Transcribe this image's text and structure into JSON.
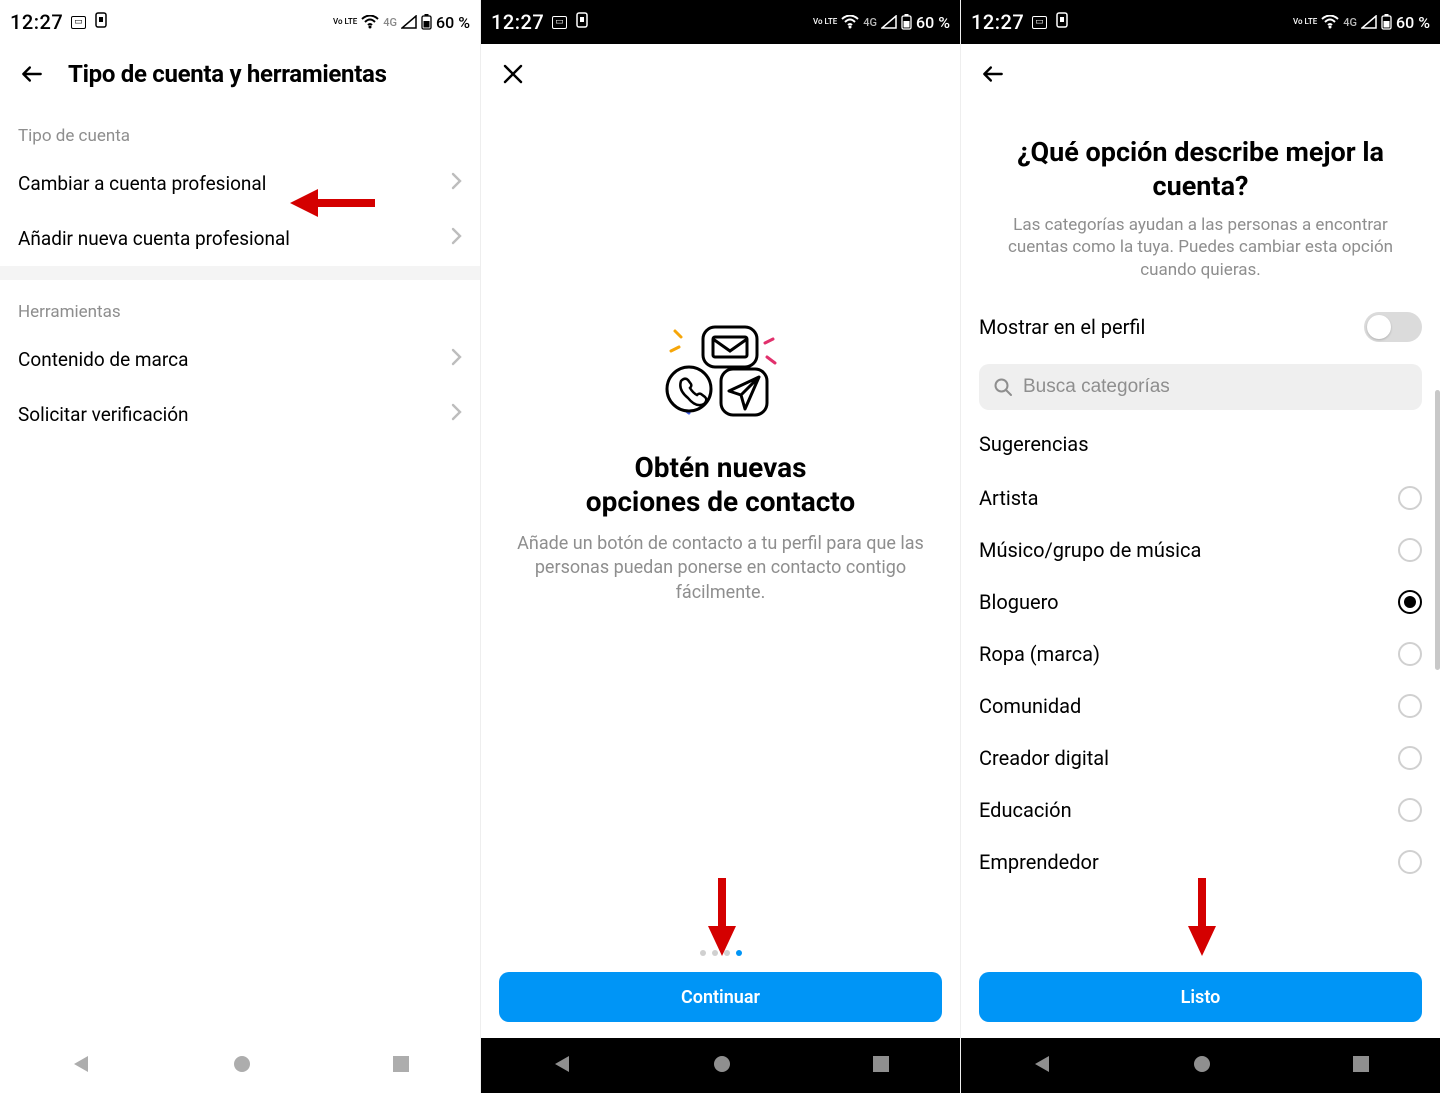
{
  "status": {
    "time": "12:27",
    "battery_text": "60 %",
    "network_label": "4G",
    "lte_label": "Vo LTE"
  },
  "screen1": {
    "title": "Tipo de cuenta y herramientas",
    "section_account": "Tipo de cuenta",
    "item_switch": "Cambiar a cuenta profesional",
    "item_add": "Añadir nueva cuenta profesional",
    "section_tools": "Herramientas",
    "item_branded": "Contenido de marca",
    "item_verify": "Solicitar verificación"
  },
  "screen2": {
    "title_line1": "Obtén nuevas",
    "title_line2": "opciones de contacto",
    "desc": "Añade un botón de contacto a tu perfil para que las personas puedan ponerse en contacto contigo fácilmente.",
    "button": "Continuar",
    "dots_total": 4,
    "dots_active_index": 3
  },
  "screen3": {
    "title": "¿Qué opción describe mejor la cuenta?",
    "desc": "Las categorías ayudan a las personas a encontrar cuentas como la tuya. Puedes cambiar esta opción cuando quieras.",
    "toggle_label": "Mostrar en el perfil",
    "toggle_on": false,
    "search_placeholder": "Busca categorías",
    "suggestions_label": "Sugerencias",
    "categories": [
      {
        "label": "Artista",
        "selected": false
      },
      {
        "label": "Músico/grupo de música",
        "selected": false
      },
      {
        "label": "Bloguero",
        "selected": true
      },
      {
        "label": "Ropa (marca)",
        "selected": false
      },
      {
        "label": "Comunidad",
        "selected": false
      },
      {
        "label": "Creador digital",
        "selected": false
      },
      {
        "label": "Educación",
        "selected": false
      },
      {
        "label": "Emprendedor",
        "selected": false
      }
    ],
    "button": "Listo"
  },
  "colors": {
    "primary": "#0095f6",
    "arrow": "#d40000"
  }
}
